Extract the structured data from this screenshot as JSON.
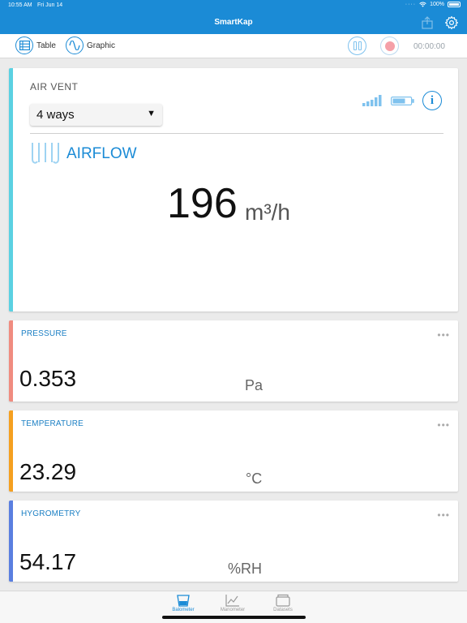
{
  "status": {
    "time": "10:55 AM",
    "date": "Fri Jun 14",
    "battery": "100%"
  },
  "nav": {
    "title": "SmartKap"
  },
  "toolbar": {
    "table_label": "Table",
    "graphic_label": "Graphic",
    "timer": "00:00:00"
  },
  "main": {
    "section_label": "AIR VENT",
    "select_value": "4 ways",
    "metric_label": "AIRFLOW",
    "value": "196",
    "unit": "m³/h",
    "accent": "#5bd1e2"
  },
  "cards": [
    {
      "label": "PRESSURE",
      "value": "0.353",
      "unit": "Pa",
      "color": "#f08c80"
    },
    {
      "label": "TEMPERATURE",
      "value": "23.29",
      "unit": "°C",
      "color": "#f5a020"
    },
    {
      "label": "HYGROMETRY",
      "value": "54.17",
      "unit": "%RH",
      "color": "#5a7fe0"
    }
  ],
  "tabs": [
    {
      "label": "Balometer",
      "active": true
    },
    {
      "label": "Manometer",
      "active": false
    },
    {
      "label": "Datasets",
      "active": false
    }
  ],
  "colors": {
    "brand": "#1b8bd6"
  },
  "icons": [
    "wifi-icon",
    "battery-icon",
    "share-icon",
    "gear-icon",
    "table-icon",
    "wave-icon",
    "pause-icon",
    "record-icon",
    "signal-icon",
    "device-battery-icon",
    "info-icon",
    "airflow-icon",
    "more-icon",
    "balometer-icon",
    "manometer-icon",
    "datasets-icon"
  ]
}
